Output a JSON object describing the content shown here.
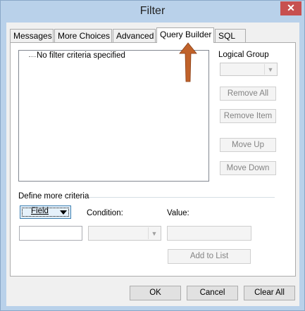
{
  "window": {
    "title": "Filter",
    "close_glyph": "✕"
  },
  "tabs": [
    {
      "label": "Messages"
    },
    {
      "label": "More Choices"
    },
    {
      "label": "Advanced"
    },
    {
      "label": "Query Builder"
    },
    {
      "label": "SQL"
    }
  ],
  "active_tab": "Query Builder",
  "criteria_list": {
    "items": [
      "No filter criteria specified"
    ]
  },
  "logical_group": {
    "label": "Logical Group",
    "value": ""
  },
  "buttons": {
    "remove_all": "Remove All",
    "remove_item": "Remove Item",
    "move_up": "Move Up",
    "move_down": "Move Down",
    "add_to_list": "Add to List",
    "ok": "OK",
    "cancel": "Cancel",
    "clear_all": "Clear All"
  },
  "define": {
    "group_label": "Define more criteria",
    "field_label": "Field",
    "condition_label": "Condition:",
    "value_label": "Value:",
    "field_value": "",
    "condition_value": "",
    "value_value": ""
  },
  "colors": {
    "annotation_arrow": "#c0622a",
    "accent": "#3c7fb1",
    "close": "#c75050"
  }
}
